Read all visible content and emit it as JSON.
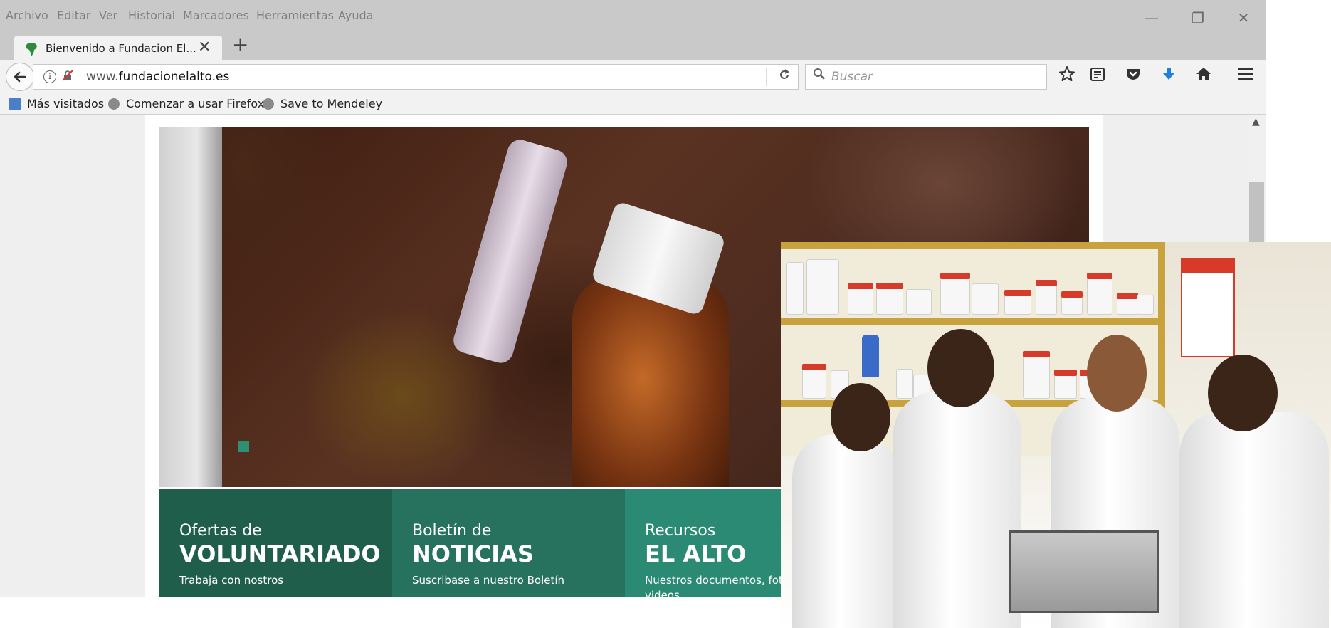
{
  "menubar": {
    "items": [
      "Archivo",
      "Editar",
      "Ver",
      "Historial",
      "Marcadores",
      "Herramientas",
      "Ayuda"
    ]
  },
  "window": {
    "minimize_glyph": "—",
    "restore_glyph": "❐",
    "close_glyph": "✕"
  },
  "tab": {
    "title": "Bienvenido a Fundacion El...",
    "favicon": "africa-icon",
    "close_glyph": "✕",
    "new_tab_glyph": "+"
  },
  "navbar": {
    "url_prefix": "www.",
    "url_domain": "fundacionelalto.es",
    "search_placeholder": "Buscar",
    "icons": [
      "back-arrow-icon",
      "info-icon",
      "tracking-icon",
      "reload-icon",
      "bookmark-star-icon",
      "reader-list-icon",
      "pocket-icon",
      "download-arrow-icon",
      "home-icon",
      "hamburger-menu-icon"
    ],
    "colors": {
      "download": "#1f7fe0"
    }
  },
  "bookmarks": {
    "items": [
      "Más visitados",
      "Comenzar a usar Firefox",
      "Save to Mendeley"
    ]
  },
  "site": {
    "panels": [
      {
        "small": "Ofertas de",
        "big": "VOLUNTARIADO",
        "desc": "Trabaja con nostros"
      },
      {
        "small": "Boletín de",
        "big": "NOTICIAS",
        "desc": "Suscribase a nuestro Boletín"
      },
      {
        "small": "Recursos",
        "big": "EL ALTO",
        "desc": "Nuestros documentos, fotos y videos."
      }
    ],
    "colors": {
      "panel1": "#205e4c",
      "panel2": "#26725e",
      "panel3": "#2b8a73",
      "slider_dot": "#2d8f74"
    }
  }
}
